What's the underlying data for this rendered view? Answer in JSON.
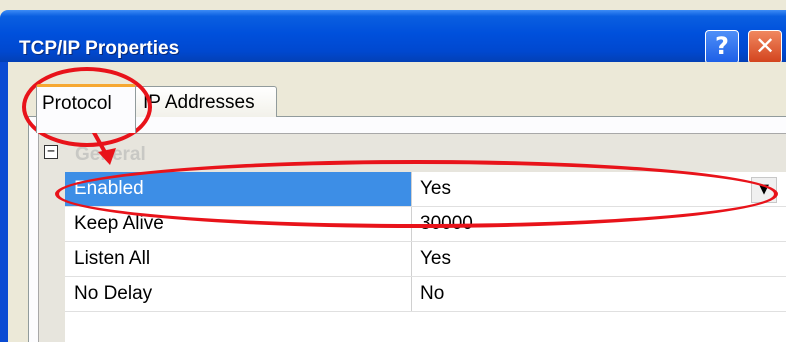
{
  "window": {
    "title": "TCP/IP Properties"
  },
  "titlebar": {
    "help_button_label": "?",
    "close_button_label": "✕"
  },
  "tabs": [
    {
      "label": "Protocol",
      "selected": true
    },
    {
      "label": "IP Addresses",
      "selected": false
    }
  ],
  "grid": {
    "group": {
      "expander_symbol": "−",
      "label": "General"
    },
    "rows": [
      {
        "name": "Enabled",
        "value": "Yes",
        "selected": true,
        "dropdown_symbol": "▼"
      },
      {
        "name": "Keep Alive",
        "value": "30000"
      },
      {
        "name": "Listen All",
        "value": "Yes"
      },
      {
        "name": "No Delay",
        "value": "No"
      }
    ]
  },
  "colors": {
    "titlebar_blue": "#0050dc",
    "selected_row_blue": "#3d8ee6",
    "active_tab_accent": "#f6a731",
    "annotation_red": "#e8131a",
    "close_button_orange": "#d2421c"
  }
}
